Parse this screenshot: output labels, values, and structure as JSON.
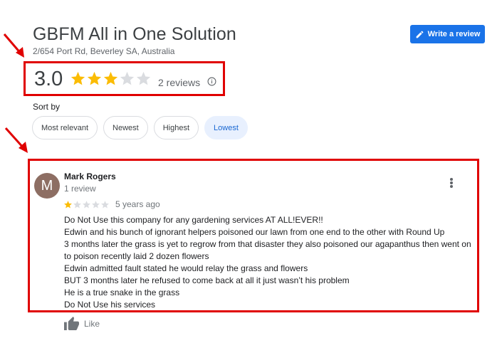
{
  "business": {
    "title": "GBFM All in One Solution",
    "address": "2/654 Port Rd, Beverley SA, Australia"
  },
  "header": {
    "write_review_label": "Write a review"
  },
  "rating": {
    "score": "3.0",
    "stars": 3,
    "max_stars": 5,
    "review_count": "2 reviews"
  },
  "sort": {
    "label": "Sort by",
    "options": [
      {
        "label": "Most relevant",
        "active": false
      },
      {
        "label": "Newest",
        "active": false
      },
      {
        "label": "Highest",
        "active": false
      },
      {
        "label": "Lowest",
        "active": true
      }
    ]
  },
  "review": {
    "avatar_letter": "M",
    "author": "Mark Rogers",
    "author_meta": "1 review",
    "stars": 1,
    "max_stars": 5,
    "date": "5 years ago",
    "lines": [
      "Do Not Use this company for any gardening services AT ALL!EVER!!",
      "Edwin and his bunch of ignorant helpers poisoned our lawn from one end to the other with Round Up",
      "3 months later the grass is yet to regrow from that disaster they also poisoned our agapanthus then went on to poison recently laid 2 dozen flowers",
      "Edwin admitted fault stated  he would relay the grass and flowers",
      "BUT 3 months later he refused to come back at all it just wasn’t his problem",
      "He is a true snake in the grass",
      "Do Not Use his services"
    ],
    "like_label": "Like"
  },
  "colors": {
    "accent": "#1a73e8",
    "star_filled": "#fbbc04",
    "star_empty": "#dadce0",
    "highlight": "#e00000",
    "avatar_bg": "#8d6e63"
  }
}
